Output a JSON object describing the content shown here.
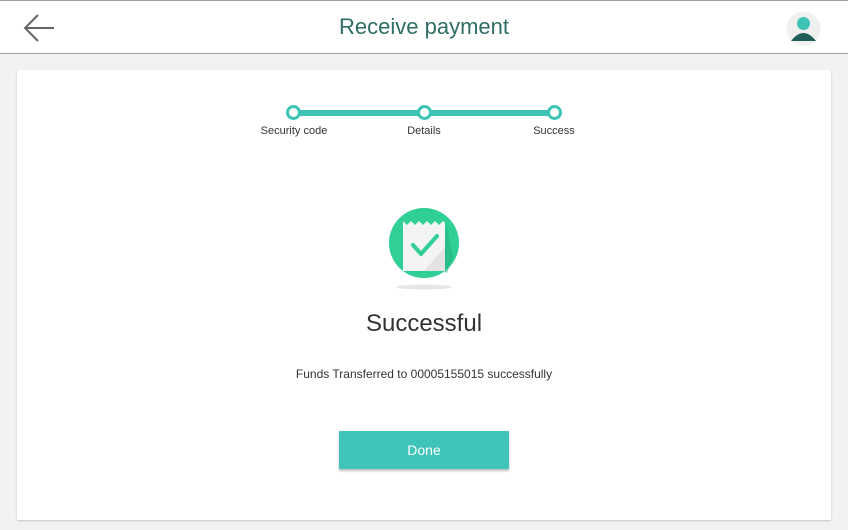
{
  "header": {
    "title": "Receive payment",
    "back_icon": "arrow-left-icon",
    "avatar_icon": "user-avatar-icon"
  },
  "stepper": {
    "steps": [
      {
        "label": "Security code",
        "state": "done"
      },
      {
        "label": "Details",
        "state": "done"
      },
      {
        "label": "Success",
        "state": "current"
      }
    ]
  },
  "result": {
    "icon": "receipt-check-icon",
    "heading": "Successful",
    "message": "Funds Transferred to 00005155015 successfully"
  },
  "actions": {
    "done_label": "Done"
  },
  "colors": {
    "accent": "#3ec4b4",
    "title": "#2e6e65",
    "success_green": "#2fcf96"
  }
}
